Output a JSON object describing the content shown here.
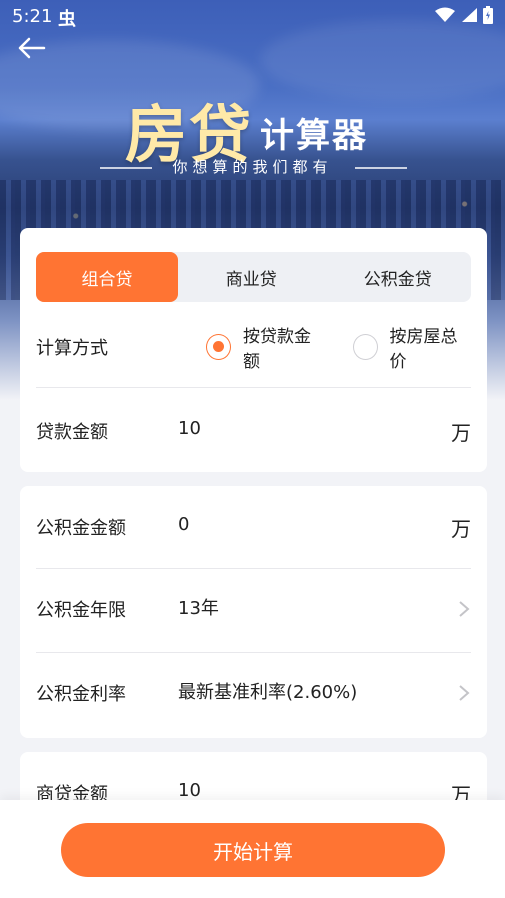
{
  "status_bar": {
    "time": "5:21",
    "app_icon": "虫"
  },
  "header": {
    "title_big": "房贷",
    "title_small": "计算器",
    "subtitle": "你想算的我们都有"
  },
  "tabs": [
    {
      "label": "组合贷",
      "active": true
    },
    {
      "label": "商业贷",
      "active": false
    },
    {
      "label": "公积金贷",
      "active": false
    }
  ],
  "calc_method": {
    "label": "计算方式",
    "options": [
      {
        "label": "按贷款金额",
        "checked": true
      },
      {
        "label": "按房屋总价",
        "checked": false
      }
    ]
  },
  "loan_amount": {
    "label": "贷款金额",
    "value": "10",
    "unit": "万"
  },
  "fund_amount": {
    "label": "公积金金额",
    "value": "0",
    "unit": "万"
  },
  "fund_years": {
    "label": "公积金年限",
    "value": "13年"
  },
  "fund_rate": {
    "label": "公积金利率",
    "value": "最新基准利率(2.60%)"
  },
  "commercial_amount": {
    "label": "商贷金额",
    "value": "10",
    "unit": "万"
  },
  "start_button": {
    "label": "开始计算"
  },
  "colors": {
    "accent": "#ff7433",
    "title_gold": "#ffe9a8"
  },
  "icons": [
    "back-arrow-icon",
    "wifi-icon",
    "signal-icon",
    "battery-icon",
    "chevron-right-icon"
  ]
}
